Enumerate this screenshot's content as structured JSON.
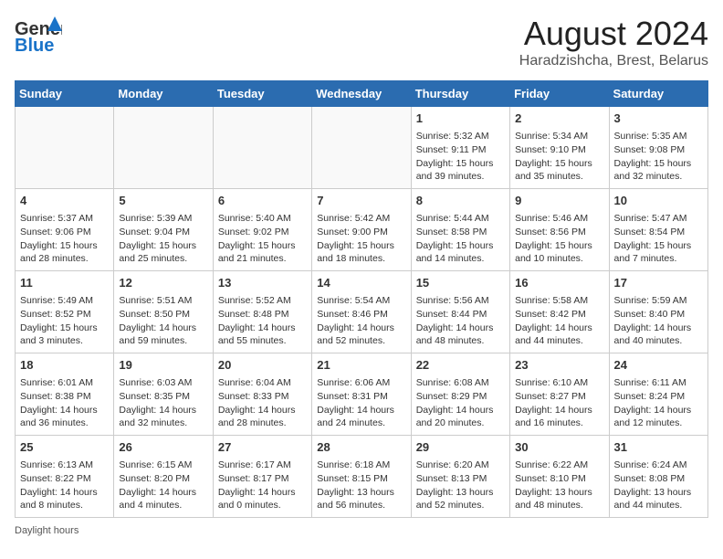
{
  "header": {
    "logo_line1": "General",
    "logo_line2": "Blue",
    "title": "August 2024",
    "subtitle": "Haradzishcha, Brest, Belarus"
  },
  "weekdays": [
    "Sunday",
    "Monday",
    "Tuesday",
    "Wednesday",
    "Thursday",
    "Friday",
    "Saturday"
  ],
  "weeks": [
    [
      {
        "day": "",
        "sunrise": "",
        "sunset": "",
        "daylight": ""
      },
      {
        "day": "",
        "sunrise": "",
        "sunset": "",
        "daylight": ""
      },
      {
        "day": "",
        "sunrise": "",
        "sunset": "",
        "daylight": ""
      },
      {
        "day": "",
        "sunrise": "",
        "sunset": "",
        "daylight": ""
      },
      {
        "day": "1",
        "sunrise": "Sunrise: 5:32 AM",
        "sunset": "Sunset: 9:11 PM",
        "daylight": "Daylight: 15 hours and 39 minutes."
      },
      {
        "day": "2",
        "sunrise": "Sunrise: 5:34 AM",
        "sunset": "Sunset: 9:10 PM",
        "daylight": "Daylight: 15 hours and 35 minutes."
      },
      {
        "day": "3",
        "sunrise": "Sunrise: 5:35 AM",
        "sunset": "Sunset: 9:08 PM",
        "daylight": "Daylight: 15 hours and 32 minutes."
      }
    ],
    [
      {
        "day": "4",
        "sunrise": "Sunrise: 5:37 AM",
        "sunset": "Sunset: 9:06 PM",
        "daylight": "Daylight: 15 hours and 28 minutes."
      },
      {
        "day": "5",
        "sunrise": "Sunrise: 5:39 AM",
        "sunset": "Sunset: 9:04 PM",
        "daylight": "Daylight: 15 hours and 25 minutes."
      },
      {
        "day": "6",
        "sunrise": "Sunrise: 5:40 AM",
        "sunset": "Sunset: 9:02 PM",
        "daylight": "Daylight: 15 hours and 21 minutes."
      },
      {
        "day": "7",
        "sunrise": "Sunrise: 5:42 AM",
        "sunset": "Sunset: 9:00 PM",
        "daylight": "Daylight: 15 hours and 18 minutes."
      },
      {
        "day": "8",
        "sunrise": "Sunrise: 5:44 AM",
        "sunset": "Sunset: 8:58 PM",
        "daylight": "Daylight: 15 hours and 14 minutes."
      },
      {
        "day": "9",
        "sunrise": "Sunrise: 5:46 AM",
        "sunset": "Sunset: 8:56 PM",
        "daylight": "Daylight: 15 hours and 10 minutes."
      },
      {
        "day": "10",
        "sunrise": "Sunrise: 5:47 AM",
        "sunset": "Sunset: 8:54 PM",
        "daylight": "Daylight: 15 hours and 7 minutes."
      }
    ],
    [
      {
        "day": "11",
        "sunrise": "Sunrise: 5:49 AM",
        "sunset": "Sunset: 8:52 PM",
        "daylight": "Daylight: 15 hours and 3 minutes."
      },
      {
        "day": "12",
        "sunrise": "Sunrise: 5:51 AM",
        "sunset": "Sunset: 8:50 PM",
        "daylight": "Daylight: 14 hours and 59 minutes."
      },
      {
        "day": "13",
        "sunrise": "Sunrise: 5:52 AM",
        "sunset": "Sunset: 8:48 PM",
        "daylight": "Daylight: 14 hours and 55 minutes."
      },
      {
        "day": "14",
        "sunrise": "Sunrise: 5:54 AM",
        "sunset": "Sunset: 8:46 PM",
        "daylight": "Daylight: 14 hours and 52 minutes."
      },
      {
        "day": "15",
        "sunrise": "Sunrise: 5:56 AM",
        "sunset": "Sunset: 8:44 PM",
        "daylight": "Daylight: 14 hours and 48 minutes."
      },
      {
        "day": "16",
        "sunrise": "Sunrise: 5:58 AM",
        "sunset": "Sunset: 8:42 PM",
        "daylight": "Daylight: 14 hours and 44 minutes."
      },
      {
        "day": "17",
        "sunrise": "Sunrise: 5:59 AM",
        "sunset": "Sunset: 8:40 PM",
        "daylight": "Daylight: 14 hours and 40 minutes."
      }
    ],
    [
      {
        "day": "18",
        "sunrise": "Sunrise: 6:01 AM",
        "sunset": "Sunset: 8:38 PM",
        "daylight": "Daylight: 14 hours and 36 minutes."
      },
      {
        "day": "19",
        "sunrise": "Sunrise: 6:03 AM",
        "sunset": "Sunset: 8:35 PM",
        "daylight": "Daylight: 14 hours and 32 minutes."
      },
      {
        "day": "20",
        "sunrise": "Sunrise: 6:04 AM",
        "sunset": "Sunset: 8:33 PM",
        "daylight": "Daylight: 14 hours and 28 minutes."
      },
      {
        "day": "21",
        "sunrise": "Sunrise: 6:06 AM",
        "sunset": "Sunset: 8:31 PM",
        "daylight": "Daylight: 14 hours and 24 minutes."
      },
      {
        "day": "22",
        "sunrise": "Sunrise: 6:08 AM",
        "sunset": "Sunset: 8:29 PM",
        "daylight": "Daylight: 14 hours and 20 minutes."
      },
      {
        "day": "23",
        "sunrise": "Sunrise: 6:10 AM",
        "sunset": "Sunset: 8:27 PM",
        "daylight": "Daylight: 14 hours and 16 minutes."
      },
      {
        "day": "24",
        "sunrise": "Sunrise: 6:11 AM",
        "sunset": "Sunset: 8:24 PM",
        "daylight": "Daylight: 14 hours and 12 minutes."
      }
    ],
    [
      {
        "day": "25",
        "sunrise": "Sunrise: 6:13 AM",
        "sunset": "Sunset: 8:22 PM",
        "daylight": "Daylight: 14 hours and 8 minutes."
      },
      {
        "day": "26",
        "sunrise": "Sunrise: 6:15 AM",
        "sunset": "Sunset: 8:20 PM",
        "daylight": "Daylight: 14 hours and 4 minutes."
      },
      {
        "day": "27",
        "sunrise": "Sunrise: 6:17 AM",
        "sunset": "Sunset: 8:17 PM",
        "daylight": "Daylight: 14 hours and 0 minutes."
      },
      {
        "day": "28",
        "sunrise": "Sunrise: 6:18 AM",
        "sunset": "Sunset: 8:15 PM",
        "daylight": "Daylight: 13 hours and 56 minutes."
      },
      {
        "day": "29",
        "sunrise": "Sunrise: 6:20 AM",
        "sunset": "Sunset: 8:13 PM",
        "daylight": "Daylight: 13 hours and 52 minutes."
      },
      {
        "day": "30",
        "sunrise": "Sunrise: 6:22 AM",
        "sunset": "Sunset: 8:10 PM",
        "daylight": "Daylight: 13 hours and 48 minutes."
      },
      {
        "day": "31",
        "sunrise": "Sunrise: 6:24 AM",
        "sunset": "Sunset: 8:08 PM",
        "daylight": "Daylight: 13 hours and 44 minutes."
      }
    ]
  ],
  "footer": {
    "note": "Daylight hours"
  }
}
